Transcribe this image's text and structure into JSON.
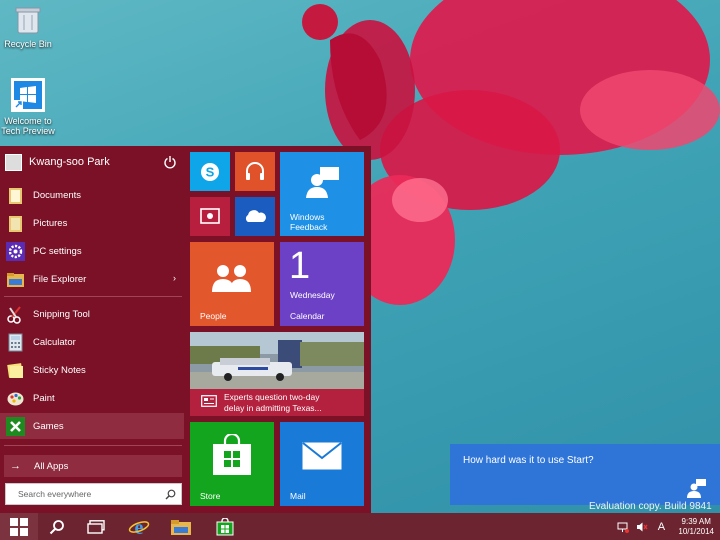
{
  "desktop": {
    "icons": [
      {
        "label": "Recycle Bin",
        "icon": "recycle-bin-icon"
      },
      {
        "label": "Welcome to Tech Preview",
        "label_line1": "Welcome to",
        "label_line2": "Tech Preview",
        "icon": "windows-shortcut-icon"
      }
    ],
    "watermark": "Evaluation copy. Build 9841"
  },
  "start_menu": {
    "user_name": "Kwang-soo Park",
    "pinned": [
      {
        "label": "Documents",
        "icon": "folder-icon"
      },
      {
        "label": "Pictures",
        "icon": "folder-icon"
      },
      {
        "label": "PC settings",
        "icon": "gear-icon"
      },
      {
        "label": "File Explorer",
        "icon": "file-explorer-icon",
        "arrow": "›"
      }
    ],
    "recent": [
      {
        "label": "Snipping Tool",
        "icon": "scissors-icon"
      },
      {
        "label": "Calculator",
        "icon": "calculator-icon"
      },
      {
        "label": "Sticky Notes",
        "icon": "sticky-notes-icon"
      },
      {
        "label": "Paint",
        "icon": "paint-palette-icon"
      },
      {
        "label": "Games",
        "icon": "xbox-games-icon"
      }
    ],
    "all_apps": "All Apps",
    "search_placeholder": "Search everywhere",
    "tiles": {
      "windows_feedback": {
        "line1": "Windows",
        "line2": "Feedback"
      },
      "people": "People",
      "calendar": {
        "day": "1",
        "weekday": "Wednesday",
        "label": "Calendar"
      },
      "news": {
        "line1": "Experts question two-day",
        "line2": "delay in admitting Texas..."
      },
      "store": "Store",
      "mail": "Mail"
    },
    "colors": {
      "background": "#7a1127",
      "skype": "#0ea5e9",
      "music": "#e0532a",
      "video": "#b81f3f",
      "onedrive": "#1a5cbf",
      "feedback": "#1e90e6",
      "people": "#e3572d",
      "calendar": "#6d41c6",
      "news": "#b3213e",
      "store": "#14a51e",
      "mail": "#1a7ad8"
    }
  },
  "notification": {
    "text": "How hard was it to use Start?"
  },
  "taskbar": {
    "apps": [
      "windows-start-icon",
      "search-icon",
      "task-view-icon",
      "internet-explorer-icon",
      "file-explorer-icon",
      "store-icon"
    ],
    "tray": {
      "input_indicator": "A",
      "time": "9:39 AM",
      "date": "10/1/2014"
    }
  }
}
